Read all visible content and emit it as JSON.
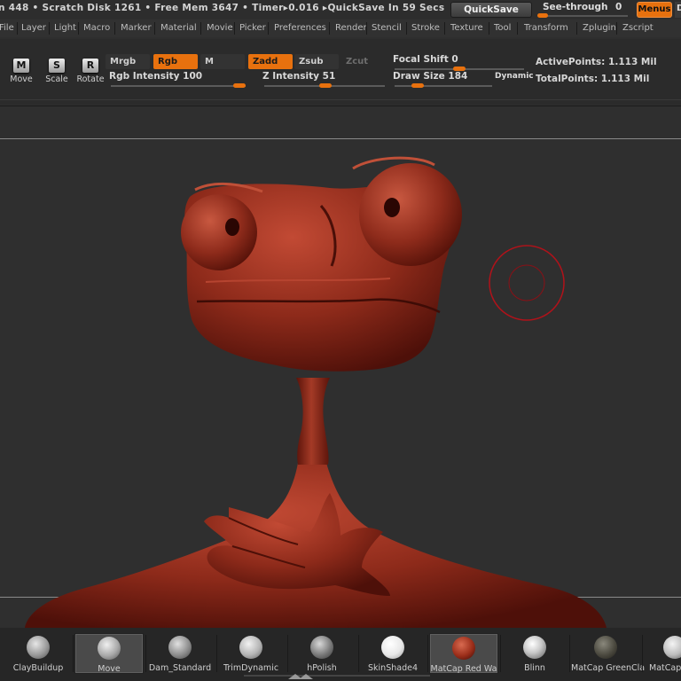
{
  "status": {
    "text": "n 448 • Scratch Disk 1261 • Free Mem 3647 • Timer▸0.016 ▸QuickSave In 59 Secs",
    "quicksave_label": "QuickSave",
    "seethrough_label": "See-through",
    "seethrough_value": "0",
    "menus_label": "Menus",
    "d_label": "D"
  },
  "menubar": {
    "items": [
      "File",
      "Layer",
      "Light",
      "Macro",
      "Marker",
      "Material",
      "Movie",
      "Picker",
      "Preferences",
      "Render",
      "Stencil",
      "Stroke",
      "Texture",
      "Tool",
      "Transform",
      "Zplugin",
      "Zscript"
    ]
  },
  "shelf": {
    "tools": [
      {
        "icon": "M",
        "label": "Move"
      },
      {
        "icon": "S",
        "label": "Scale"
      },
      {
        "icon": "R",
        "label": "Rotate"
      }
    ],
    "mrgb": "Mrgb",
    "rgb": "Rgb",
    "m": "M",
    "zadd": "Zadd",
    "zsub": "Zsub",
    "zcut": "Zcut",
    "rgb_intensity": {
      "label": "Rgb Intensity",
      "value": "100",
      "fraction": 1.0
    },
    "z_intensity": {
      "label": "Z Intensity",
      "value": "51",
      "fraction": 0.51
    },
    "focal_shift": {
      "label": "Focal Shift",
      "value": "0",
      "fraction": 0.5
    },
    "draw_size": {
      "label": "Draw Size",
      "value": "184",
      "fraction": 0.2
    },
    "dynamic": "Dynamic",
    "active_points": "ActivePoints: 1.113 Mil",
    "total_points": "TotalPoints: 1.113 Mil"
  },
  "bottom": {
    "brushes": [
      {
        "label": "ClayBuildup",
        "color": "#9a9a9a"
      },
      {
        "label": "Move",
        "color": "#a8a8a8"
      },
      {
        "label": "Dam_Standard",
        "color": "#8e8e8e"
      },
      {
        "label": "TrimDynamic",
        "color": "#b5b5b5"
      },
      {
        "label": "hPolish",
        "color": "#7a7a7a"
      },
      {
        "label": "SkinShade4",
        "color": "#f0f0f0"
      },
      {
        "label": "MatCap Red Wa",
        "color": "#9b2e1a"
      },
      {
        "label": "Blinn",
        "color": "#d0d0d0"
      },
      {
        "label": "MatCap GreenCla",
        "color": "#4c4a40"
      },
      {
        "label": "MatCap",
        "color": "#bcbcbc"
      }
    ]
  },
  "colors": {
    "accent": "#e8710e",
    "clay": "#8d2a1a",
    "cursor": "#b0121a"
  }
}
